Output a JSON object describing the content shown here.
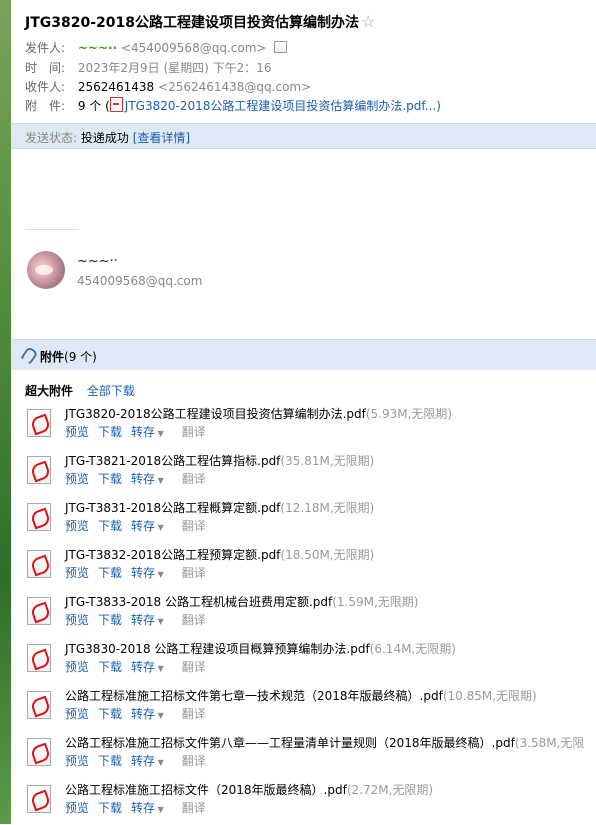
{
  "email": {
    "subject": "JTG3820-2018公路工程建设项目投资估算编制办法",
    "star_icon": "star-outline-icon",
    "sender_label": "发件人:",
    "sender_name": "~~~··",
    "sender_email": "<454009568@qq.com>",
    "time_label": "时　间:",
    "time_value": "2023年2月9日 (星期四) 下午2：16",
    "recipient_label": "收件人:",
    "recipient_name": "2562461438",
    "recipient_email": "<2562461438@qq.com>",
    "attachment_label": "附　件:",
    "attachment_count": "9 个 (",
    "attachment_first": "JTG3820-2018公路工程建设项目投资估算编制办法.pdf...)",
    "status_label": "发送状态:",
    "status_value": "投递成功",
    "status_link": "[查看详情]"
  },
  "signature": {
    "name": "~~~··",
    "email": "454009568@qq.com"
  },
  "attachments_section": {
    "title": "附件",
    "count": "(9 个)",
    "super_label": "超大附件",
    "download_all": "全部下载",
    "actions": {
      "preview": "预览",
      "download": "下载",
      "save": "转存",
      "translate": "翻译"
    },
    "files": [
      {
        "name": "JTG3820-2018公路工程建设项目投资估算编制办法.pdf",
        "meta": "(5.93M,无限期)"
      },
      {
        "name": "JTG-T3821-2018公路工程估算指标.pdf",
        "meta": "(35.81M,无限期)"
      },
      {
        "name": "JTG-T3831-2018公路工程概算定额.pdf",
        "meta": "(12.18M,无限期)"
      },
      {
        "name": "JTG-T3832-2018公路工程预算定额.pdf",
        "meta": "(18.50M,无限期)"
      },
      {
        "name": "JTG-T3833-2018 公路工程机械台班费用定额.pdf",
        "meta": "(1.59M,无限期)"
      },
      {
        "name": "JTG3830-2018 公路工程建设项目概算预算编制办法.pdf",
        "meta": "(6.14M,无限期)"
      },
      {
        "name": "公路工程标准施工招标文件第七章一技术规范（2018年版最终稿）.pdf",
        "meta": "(10.85M,无限期)"
      },
      {
        "name": "公路工程标准施工招标文件第八章——工程量清单计量规则（2018年版最终稿）.pdf",
        "meta": "(3.58M,无限"
      },
      {
        "name": "公路工程标准施工招标文件（2018年版最终稿）.pdf",
        "meta": "(2.72M,无限期)"
      }
    ]
  }
}
